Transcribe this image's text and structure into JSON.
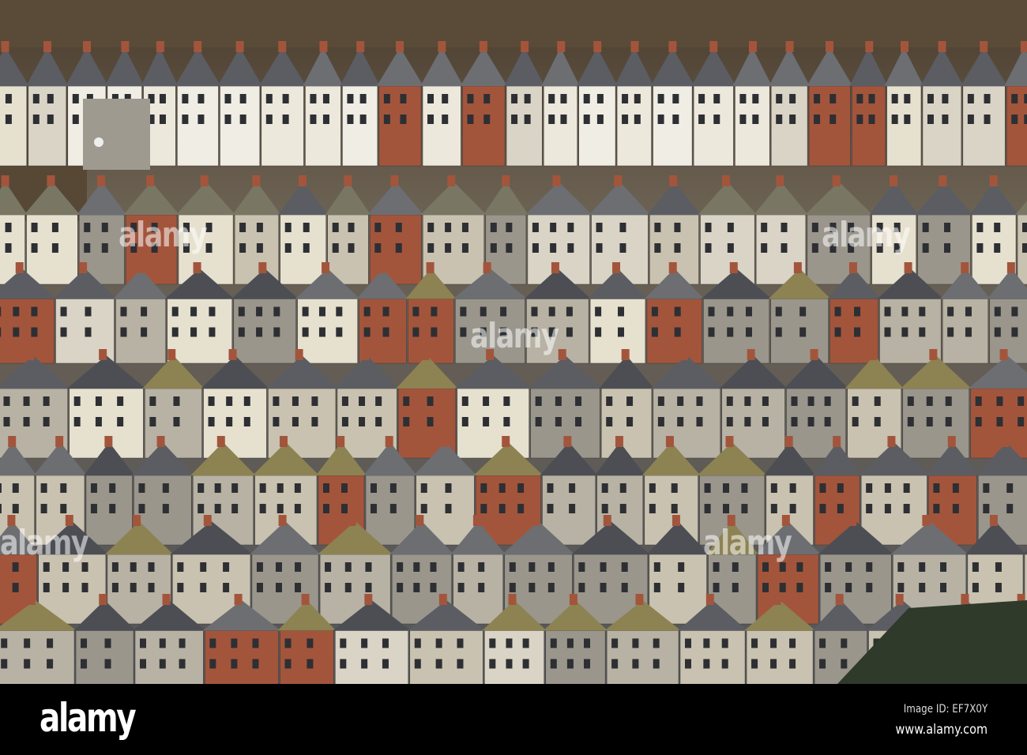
{
  "photo": {
    "subject": "hillside terraced houses",
    "colors": {
      "sky_trees": "#5a4a38",
      "cream_wall": "#e6e0cf",
      "grey_roof": "#6c6e72",
      "lichen_roof": "#8d8252",
      "brick": "#a3553c",
      "stone_wall": "#9a968c"
    }
  },
  "watermark": {
    "text": "alamy"
  },
  "footer": {
    "logo": "alamy",
    "image_id": "Image ID: EF7X0Y",
    "website": "www.alamy.com"
  }
}
